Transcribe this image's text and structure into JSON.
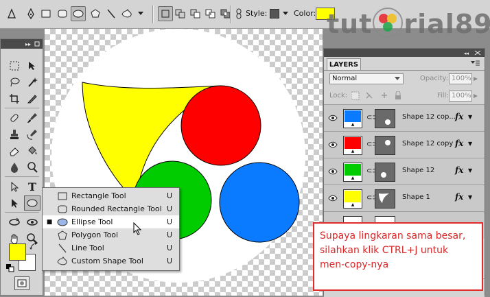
{
  "options_bar": {
    "style_label": "Style:",
    "color_label": "Color:",
    "color_value": "#ffff00",
    "style_swatch": "#555555",
    "tools": [
      "pen-icon",
      "freeform-pen-icon",
      "rectangle-icon",
      "rounded-rectangle-icon",
      "ellipse-icon",
      "polygon-icon",
      "line-icon",
      "custom-shape-icon"
    ],
    "selected_tool": "ellipse-icon"
  },
  "watermark": {
    "text_left": "tut",
    "text_right": "rial89",
    "logo_colors": [
      "#e8252b",
      "#1ea64a",
      "#2a63c9",
      "#f2c11a"
    ]
  },
  "shape_flyout": {
    "items": [
      {
        "label": "Rectangle Tool",
        "key": "U",
        "icon": "rectangle-icon",
        "selected": false
      },
      {
        "label": "Rounded Rectangle Tool",
        "key": "U",
        "icon": "rounded-rectangle-icon",
        "selected": false
      },
      {
        "label": "Ellipse Tool",
        "key": "U",
        "icon": "ellipse-icon",
        "selected": true
      },
      {
        "label": "Polygon Tool",
        "key": "U",
        "icon": "polygon-icon",
        "selected": false
      },
      {
        "label": "Line Tool",
        "key": "U",
        "icon": "line-icon",
        "selected": false
      },
      {
        "label": "Custom Shape Tool",
        "key": "U",
        "icon": "custom-shape-icon",
        "selected": false
      }
    ]
  },
  "toolbox": {
    "foreground_color": "#ffff00",
    "background_color": "#ffffff"
  },
  "canvas": {
    "shapes": [
      {
        "name": "red-circle",
        "color": "#ff0000"
      },
      {
        "name": "green-circle",
        "color": "#00cc00"
      },
      {
        "name": "blue-circle",
        "color": "#0a7bff"
      },
      {
        "name": "yellow-shape",
        "color": "#ffff00"
      }
    ]
  },
  "layers_panel": {
    "tab": "LAYERS",
    "blend_mode": "Normal",
    "opacity_label": "Opacity:",
    "opacity_value": "100%",
    "lock_label": "Lock:",
    "fill_label": "Fill:",
    "fill_value": "100%",
    "layers": [
      {
        "name": "Shape 12 cop...",
        "color": "#0a7bff",
        "fx": "fx",
        "mask_shape": "circle"
      },
      {
        "name": "Shape 12 copy",
        "color": "#ff0000",
        "fx": "fx",
        "mask_shape": "circle"
      },
      {
        "name": "Shape 12",
        "color": "#00cc00",
        "fx": "fx",
        "mask_shape": "circle"
      },
      {
        "name": "Shape 1",
        "color": "#ffff00",
        "fx": "fx",
        "mask_shape": "custom"
      }
    ]
  },
  "annotation": {
    "line1": "Supaya lingkaran sama besar,",
    "line2": "silahkan klik CTRL+J untuk",
    "line3": "men-copy-nya",
    "border_color": "#e32a2a",
    "text_color": "#d82525"
  }
}
